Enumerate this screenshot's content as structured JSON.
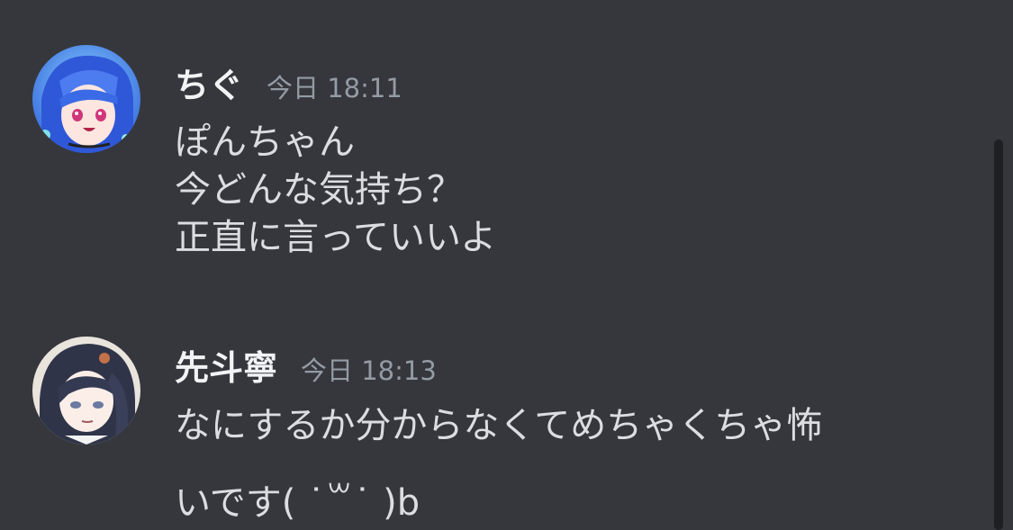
{
  "messages": [
    {
      "author": "ちぐ",
      "timestamp": "今日 18:11",
      "lines": [
        "ぽんちゃん",
        "今どんな気持ち？",
        "正直に言っていいよ"
      ]
    },
    {
      "author": "先斗寧",
      "timestamp": "今日 18:13",
      "lines": [
        "なにするか分からなくてめちゃくちゃ怖",
        "いです( ˙꒳˙ )b"
      ]
    }
  ],
  "colors": {
    "background": "#36373d",
    "author": "#f2f3f5",
    "timestamp": "#949ba4",
    "text": "#dbdee1",
    "scrollbar": "#1e1f22"
  },
  "icons": [
    "avatar-chigu",
    "avatar-ponto-nei"
  ]
}
